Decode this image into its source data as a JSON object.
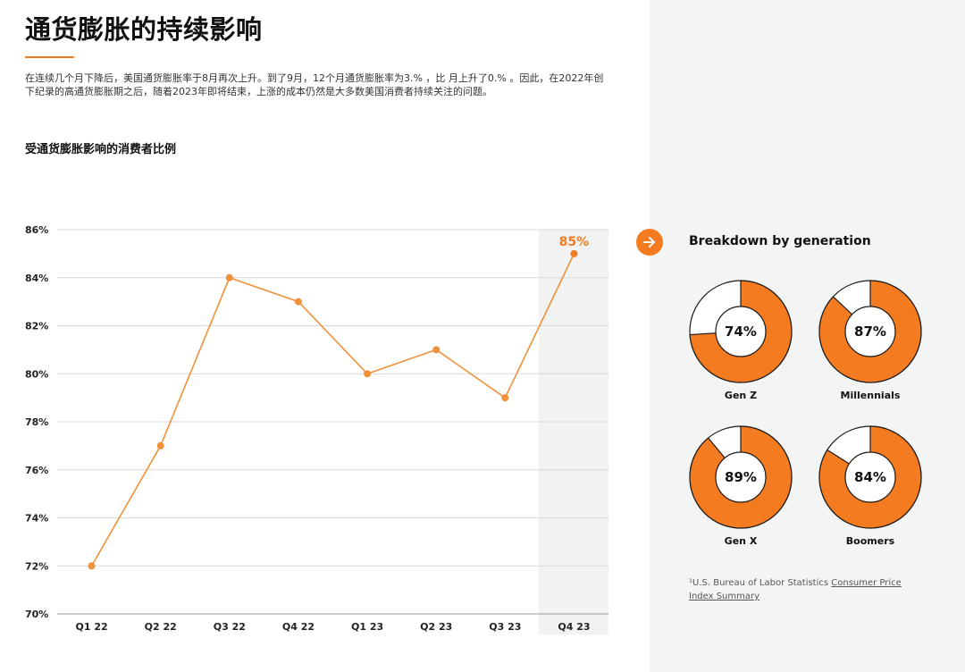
{
  "page": {
    "title": "通货膨胀的持续影响",
    "intro": "在连续几个月下降后，美国通货膨胀率于8月再次上升。到了9月，12个月通货膨胀率为3.% ，比 月上升了0.% 。因此，在2022年创下纪录的高通货膨胀期之后，随着2023年即将结束，上涨的成本仍然是大多数美国消费者持续关注的问题。"
  },
  "chart_data": {
    "type": "line",
    "title": "受通货膨胀影响的消费者比例",
    "categories": [
      "Q1 22",
      "Q2 22",
      "Q3 22",
      "Q4 22",
      "Q1 23",
      "Q2 23",
      "Q3 23",
      "Q4 23"
    ],
    "values": [
      72,
      77,
      84,
      83,
      80,
      81,
      79,
      85
    ],
    "y_ticks": [
      "70%",
      "72%",
      "74%",
      "76%",
      "78%",
      "80%",
      "82%",
      "84%",
      "86%"
    ],
    "ylim": [
      70,
      86
    ],
    "highlight_label": "85%",
    "grid": true,
    "line_color": "#f0913a",
    "highlight_color": "#f47b20",
    "highlight_band_color": "#f1f2f2"
  },
  "breakdown": {
    "title": "Breakdown by generation",
    "accent_color": "#f47b20",
    "arrow_icon": "arrow-right-icon",
    "items": [
      {
        "label": "Gen Z",
        "value": 74,
        "value_text": "74%"
      },
      {
        "label": "Millennials",
        "value": 87,
        "value_text": "87%"
      },
      {
        "label": "Gen X",
        "value": 89,
        "value_text": "89%"
      },
      {
        "label": "Boomers",
        "value": 84,
        "value_text": "84%"
      }
    ]
  },
  "footnote": {
    "prefix": "¹U.S. Bureau of Labor Statistics ",
    "link_text": "Consumer Price Index Summary"
  }
}
